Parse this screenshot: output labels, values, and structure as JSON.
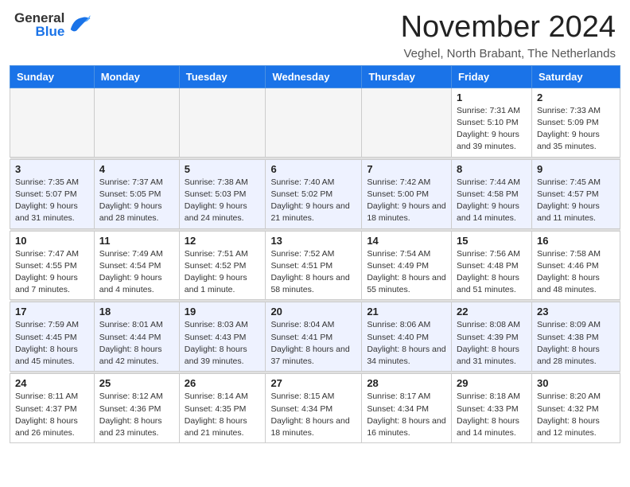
{
  "header": {
    "logo_general": "General",
    "logo_blue": "Blue",
    "month_title": "November 2024",
    "location": "Veghel, North Brabant, The Netherlands"
  },
  "weekdays": [
    "Sunday",
    "Monday",
    "Tuesday",
    "Wednesday",
    "Thursday",
    "Friday",
    "Saturday"
  ],
  "weeks": [
    [
      {
        "day": "",
        "info": ""
      },
      {
        "day": "",
        "info": ""
      },
      {
        "day": "",
        "info": ""
      },
      {
        "day": "",
        "info": ""
      },
      {
        "day": "",
        "info": ""
      },
      {
        "day": "1",
        "info": "Sunrise: 7:31 AM\nSunset: 5:10 PM\nDaylight: 9 hours and 39 minutes."
      },
      {
        "day": "2",
        "info": "Sunrise: 7:33 AM\nSunset: 5:09 PM\nDaylight: 9 hours and 35 minutes."
      }
    ],
    [
      {
        "day": "3",
        "info": "Sunrise: 7:35 AM\nSunset: 5:07 PM\nDaylight: 9 hours and 31 minutes."
      },
      {
        "day": "4",
        "info": "Sunrise: 7:37 AM\nSunset: 5:05 PM\nDaylight: 9 hours and 28 minutes."
      },
      {
        "day": "5",
        "info": "Sunrise: 7:38 AM\nSunset: 5:03 PM\nDaylight: 9 hours and 24 minutes."
      },
      {
        "day": "6",
        "info": "Sunrise: 7:40 AM\nSunset: 5:02 PM\nDaylight: 9 hours and 21 minutes."
      },
      {
        "day": "7",
        "info": "Sunrise: 7:42 AM\nSunset: 5:00 PM\nDaylight: 9 hours and 18 minutes."
      },
      {
        "day": "8",
        "info": "Sunrise: 7:44 AM\nSunset: 4:58 PM\nDaylight: 9 hours and 14 minutes."
      },
      {
        "day": "9",
        "info": "Sunrise: 7:45 AM\nSunset: 4:57 PM\nDaylight: 9 hours and 11 minutes."
      }
    ],
    [
      {
        "day": "10",
        "info": "Sunrise: 7:47 AM\nSunset: 4:55 PM\nDaylight: 9 hours and 7 minutes."
      },
      {
        "day": "11",
        "info": "Sunrise: 7:49 AM\nSunset: 4:54 PM\nDaylight: 9 hours and 4 minutes."
      },
      {
        "day": "12",
        "info": "Sunrise: 7:51 AM\nSunset: 4:52 PM\nDaylight: 9 hours and 1 minute."
      },
      {
        "day": "13",
        "info": "Sunrise: 7:52 AM\nSunset: 4:51 PM\nDaylight: 8 hours and 58 minutes."
      },
      {
        "day": "14",
        "info": "Sunrise: 7:54 AM\nSunset: 4:49 PM\nDaylight: 8 hours and 55 minutes."
      },
      {
        "day": "15",
        "info": "Sunrise: 7:56 AM\nSunset: 4:48 PM\nDaylight: 8 hours and 51 minutes."
      },
      {
        "day": "16",
        "info": "Sunrise: 7:58 AM\nSunset: 4:46 PM\nDaylight: 8 hours and 48 minutes."
      }
    ],
    [
      {
        "day": "17",
        "info": "Sunrise: 7:59 AM\nSunset: 4:45 PM\nDaylight: 8 hours and 45 minutes."
      },
      {
        "day": "18",
        "info": "Sunrise: 8:01 AM\nSunset: 4:44 PM\nDaylight: 8 hours and 42 minutes."
      },
      {
        "day": "19",
        "info": "Sunrise: 8:03 AM\nSunset: 4:43 PM\nDaylight: 8 hours and 39 minutes."
      },
      {
        "day": "20",
        "info": "Sunrise: 8:04 AM\nSunset: 4:41 PM\nDaylight: 8 hours and 37 minutes."
      },
      {
        "day": "21",
        "info": "Sunrise: 8:06 AM\nSunset: 4:40 PM\nDaylight: 8 hours and 34 minutes."
      },
      {
        "day": "22",
        "info": "Sunrise: 8:08 AM\nSunset: 4:39 PM\nDaylight: 8 hours and 31 minutes."
      },
      {
        "day": "23",
        "info": "Sunrise: 8:09 AM\nSunset: 4:38 PM\nDaylight: 8 hours and 28 minutes."
      }
    ],
    [
      {
        "day": "24",
        "info": "Sunrise: 8:11 AM\nSunset: 4:37 PM\nDaylight: 8 hours and 26 minutes."
      },
      {
        "day": "25",
        "info": "Sunrise: 8:12 AM\nSunset: 4:36 PM\nDaylight: 8 hours and 23 minutes."
      },
      {
        "day": "26",
        "info": "Sunrise: 8:14 AM\nSunset: 4:35 PM\nDaylight: 8 hours and 21 minutes."
      },
      {
        "day": "27",
        "info": "Sunrise: 8:15 AM\nSunset: 4:34 PM\nDaylight: 8 hours and 18 minutes."
      },
      {
        "day": "28",
        "info": "Sunrise: 8:17 AM\nSunset: 4:34 PM\nDaylight: 8 hours and 16 minutes."
      },
      {
        "day": "29",
        "info": "Sunrise: 8:18 AM\nSunset: 4:33 PM\nDaylight: 8 hours and 14 minutes."
      },
      {
        "day": "30",
        "info": "Sunrise: 8:20 AM\nSunset: 4:32 PM\nDaylight: 8 hours and 12 minutes."
      }
    ]
  ]
}
